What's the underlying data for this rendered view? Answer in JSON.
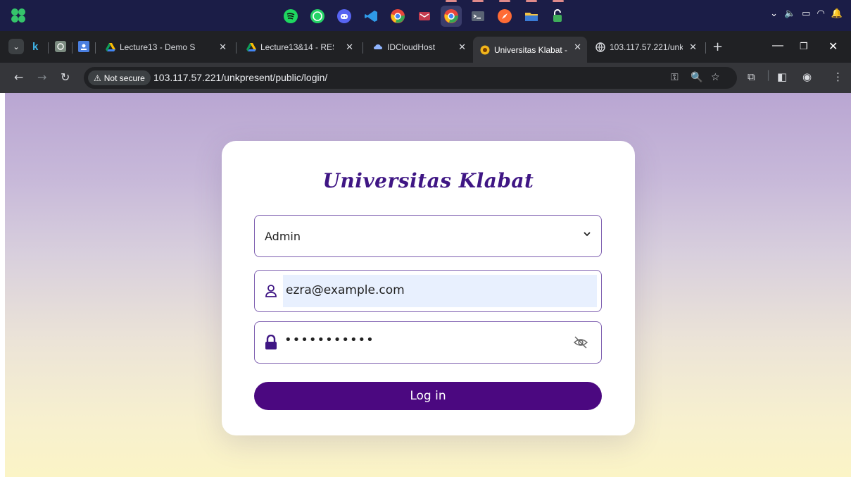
{
  "taskbar": {
    "apps": [
      "spotify-icon",
      "whatsapp-icon",
      "discord-icon",
      "vscode-icon",
      "chrome-icon",
      "mail-icon",
      "chrome-active-icon",
      "terminal-icon",
      "safari-icon",
      "folder-icon",
      "lock-app-icon"
    ]
  },
  "tabs": {
    "tab1": "Lecture13 - Demo S",
    "tab2": "Lecture13&14 - RES",
    "tab3": "IDCloudHost",
    "tab4": "Universitas Klabat -",
    "tab5": "103.117.57.221/unk"
  },
  "address": {
    "security_label": "Not secure",
    "url": "103.117.57.221/unkpresent/public/login/"
  },
  "login": {
    "brand": "Universitas Klabat",
    "role_selected": "Admin",
    "email_value": "ezra@example.com",
    "password_mask": "•••••••••••",
    "submit_label": "Log in"
  },
  "colors": {
    "brand_purple": "#3f1684",
    "button_purple": "#4b0880",
    "field_border": "#7e5fb0",
    "autofill_bg": "#e8f0fe"
  }
}
